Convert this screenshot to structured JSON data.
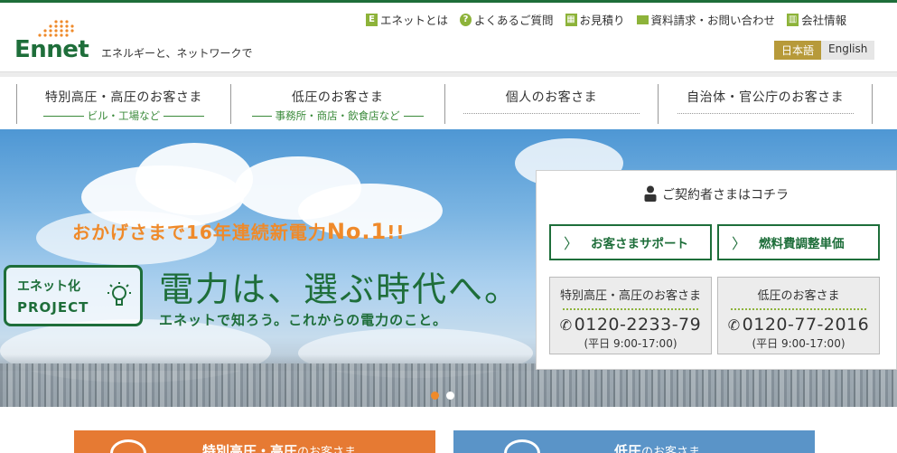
{
  "brand": {
    "logo_text": "Ennet",
    "tagline": "エネルギーと、ネットワークで",
    "green": "#1e6e3a",
    "orange": "#ef8a2a"
  },
  "utility_nav": [
    {
      "label": "エネットとは",
      "icon": "e-logo-icon"
    },
    {
      "label": "よくあるご質問",
      "icon": "question-icon"
    },
    {
      "label": "お見積り",
      "icon": "calculator-icon"
    },
    {
      "label": "資料請求・お問い合わせ",
      "icon": "mail-icon"
    },
    {
      "label": "会社情報",
      "icon": "building-icon"
    }
  ],
  "language": {
    "jp": "日本語",
    "en": "English",
    "selected": "日本語"
  },
  "main_nav": [
    {
      "title": "特別高圧・高圧のお客さま",
      "sub": "ビル・工場など"
    },
    {
      "title": "低圧のお客さま",
      "sub": "事務所・商店・飲食店など"
    },
    {
      "title": "個人のお客さま",
      "sub": ""
    },
    {
      "title": "自治体・官公庁のお客さま",
      "sub": ""
    }
  ],
  "hero": {
    "catch_main": "おかげさまで16年連続新電力",
    "catch_no1": "No.1",
    "catch_end": "!!",
    "project_line1": "エネット化",
    "project_line2": "PROJECT",
    "headline": "電力は、選ぶ時代へ。",
    "subline": "エネットで知ろう。これからの電力のこと。",
    "slides": 2,
    "active_slide": 1
  },
  "contract_panel": {
    "title": "ご契約者さまはコチラ",
    "btn_support": "お客さまサポート",
    "btn_fuel": "燃料費調整単価",
    "tel_high": {
      "title": "特別高圧・高圧のお客さま",
      "number": "0120-2233-79",
      "hours": "(平日 9:00-17:00)"
    },
    "tel_low": {
      "title": "低圧のお客さま",
      "number": "0120-77-2016",
      "hours": "(平日 9:00-17:00)"
    }
  },
  "bottom_buttons": {
    "high_main": "特別高圧・高圧",
    "high_suffix": "のお客さま",
    "low_main": "低圧",
    "low_suffix": "のお客さま"
  }
}
